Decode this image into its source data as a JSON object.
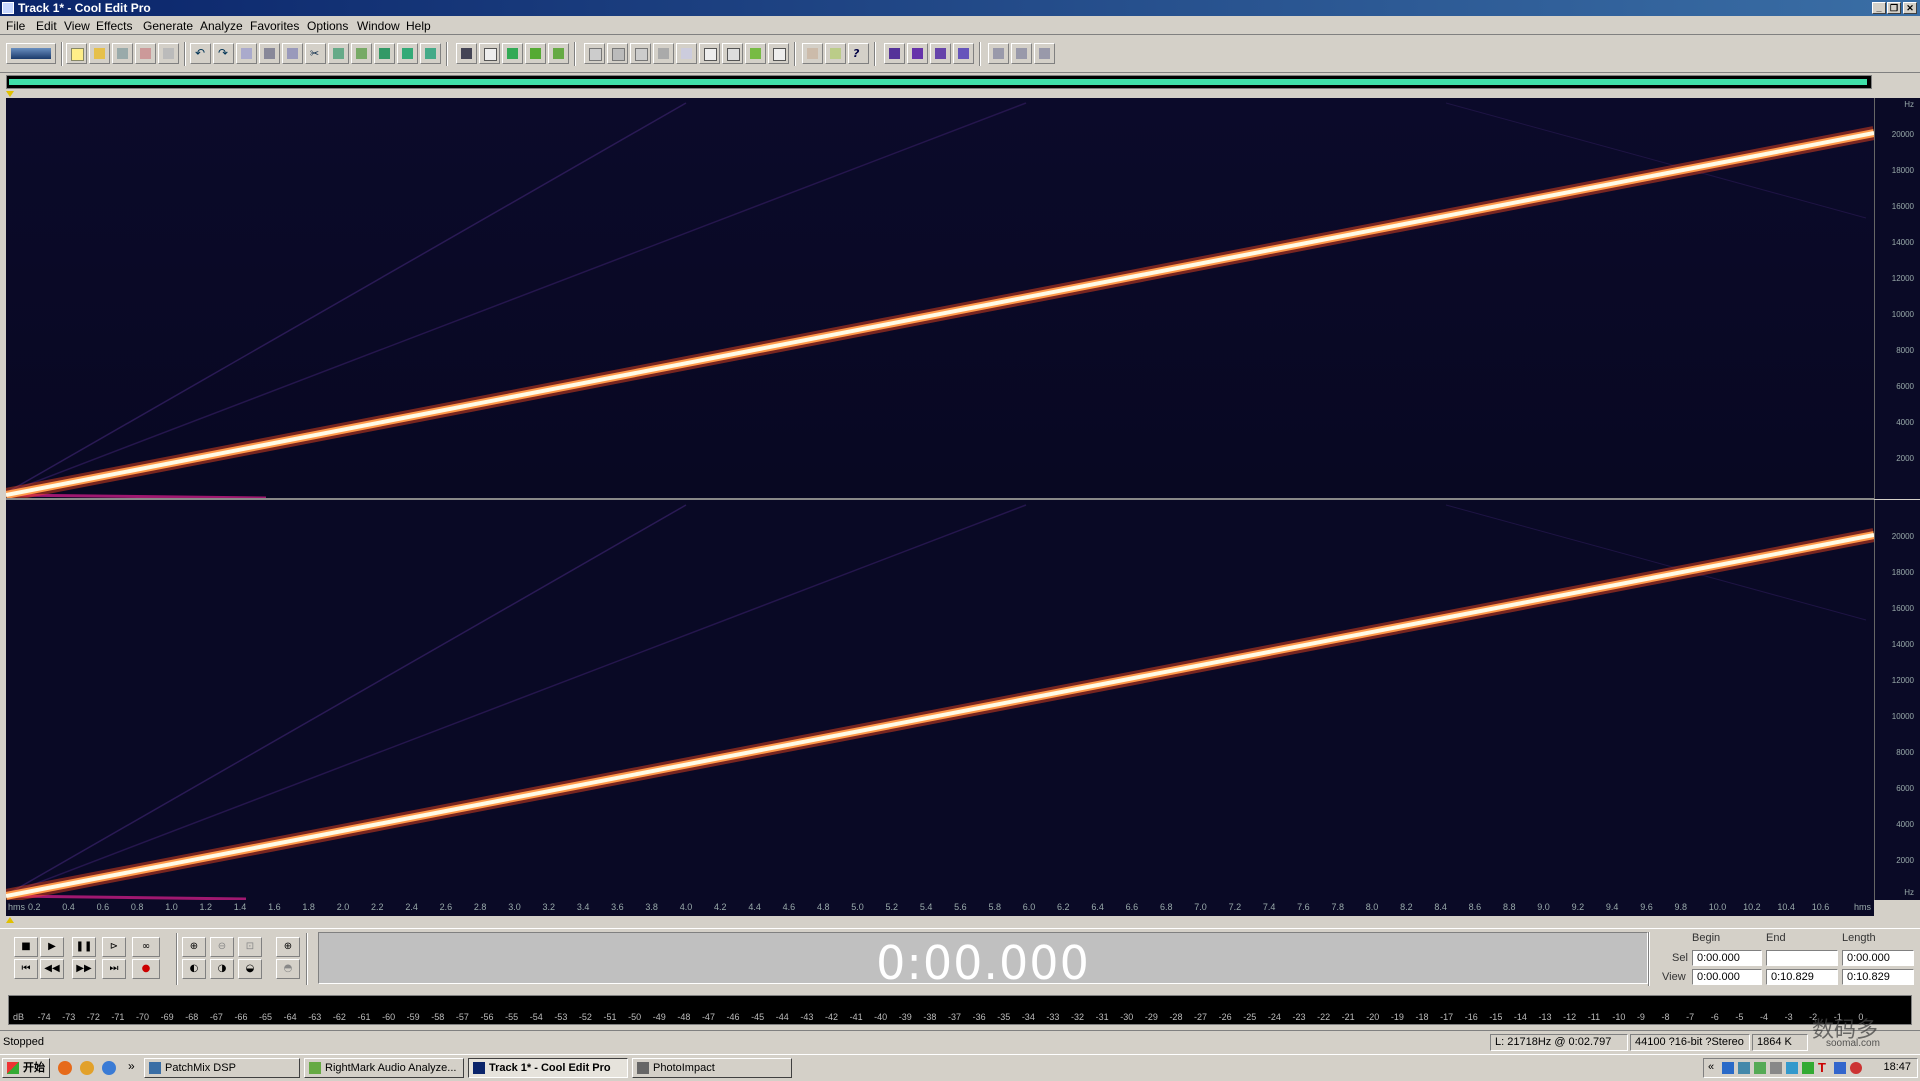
{
  "window": {
    "title": "Track 1* - Cool Edit Pro"
  },
  "menu": [
    "File",
    "Edit",
    "View",
    "Effects",
    "Generate",
    "Analyze",
    "Favorites",
    "Options",
    "Window",
    "Help"
  ],
  "colors": {
    "spectrum_bg": "#0a0a26",
    "sweep_core": "#fffbe6",
    "sweep_glow": "#ff6a3a",
    "overview_bar": "#3fe0a8",
    "title_gradient_start": "#0a246a",
    "title_gradient_end": "#3a6ea5"
  },
  "spectral": {
    "freq_axis_unit": "Hz",
    "freq_labels": [
      "20000",
      "18000",
      "16000",
      "14000",
      "12000",
      "10000",
      "8000",
      "6000",
      "4000",
      "2000"
    ],
    "time_labels": [
      "hms",
      "0.2",
      "0.4",
      "0.6",
      "0.8",
      "1.0",
      "1.2",
      "1.4",
      "1.6",
      "1.8",
      "2.0",
      "2.2",
      "2.4",
      "2.6",
      "2.8",
      "3.0",
      "3.2",
      "3.4",
      "3.6",
      "3.8",
      "4.0",
      "4.2",
      "4.4",
      "4.6",
      "4.8",
      "5.0",
      "5.2",
      "5.4",
      "5.6",
      "5.8",
      "6.0",
      "6.2",
      "6.4",
      "6.6",
      "6.8",
      "7.0",
      "7.2",
      "7.4",
      "7.6",
      "7.8",
      "8.0",
      "8.2",
      "8.4",
      "8.6",
      "8.8",
      "9.0",
      "9.2",
      "9.4",
      "9.6",
      "9.8",
      "10.0",
      "10.2",
      "10.4",
      "10.6",
      "hms"
    ],
    "sweep_start_hz": 0,
    "sweep_end_hz": 20000
  },
  "transport": {
    "time": "0:00.000"
  },
  "selection": {
    "headers": {
      "begin": "Begin",
      "end": "End",
      "length": "Length"
    },
    "sel_label": "Sel",
    "view_label": "View",
    "sel": {
      "begin": "0:00.000",
      "end": "",
      "length": "0:00.000"
    },
    "view": {
      "begin": "0:00.000",
      "end": "0:10.829",
      "length": "0:10.829"
    }
  },
  "level_meter": {
    "labels": [
      "dB",
      "-74",
      "-73",
      "-72",
      "-71",
      "-70",
      "-69",
      "-68",
      "-67",
      "-66",
      "-65",
      "-64",
      "-63",
      "-62",
      "-61",
      "-60",
      "-59",
      "-58",
      "-57",
      "-56",
      "-55",
      "-54",
      "-53",
      "-52",
      "-51",
      "-50",
      "-49",
      "-48",
      "-47",
      "-46",
      "-45",
      "-44",
      "-43",
      "-42",
      "-41",
      "-40",
      "-39",
      "-38",
      "-37",
      "-36",
      "-35",
      "-34",
      "-33",
      "-32",
      "-31",
      "-30",
      "-29",
      "-28",
      "-27",
      "-26",
      "-25",
      "-24",
      "-23",
      "-22",
      "-21",
      "-20",
      "-19",
      "-18",
      "-17",
      "-16",
      "-15",
      "-14",
      "-13",
      "-12",
      "-11",
      "-10",
      "-9",
      "-8",
      "-7",
      "-6",
      "-5",
      "-4",
      "-3",
      "-2",
      "-1",
      "0"
    ]
  },
  "status": {
    "state": "Stopped",
    "cursor": "L: 21718Hz @  0:02.797",
    "format": "44100 ?16-bit ?Stereo",
    "size": "1864 K"
  },
  "taskbar": {
    "start": "开始",
    "tasks": [
      "PatchMix DSP",
      "RightMark Audio Analyze...",
      "Track 1* - Cool Edit Pro",
      "PhotoImpact"
    ],
    "clock": "18:47"
  },
  "watermark": {
    "main": "数码多",
    "sub": "soomal.com"
  }
}
